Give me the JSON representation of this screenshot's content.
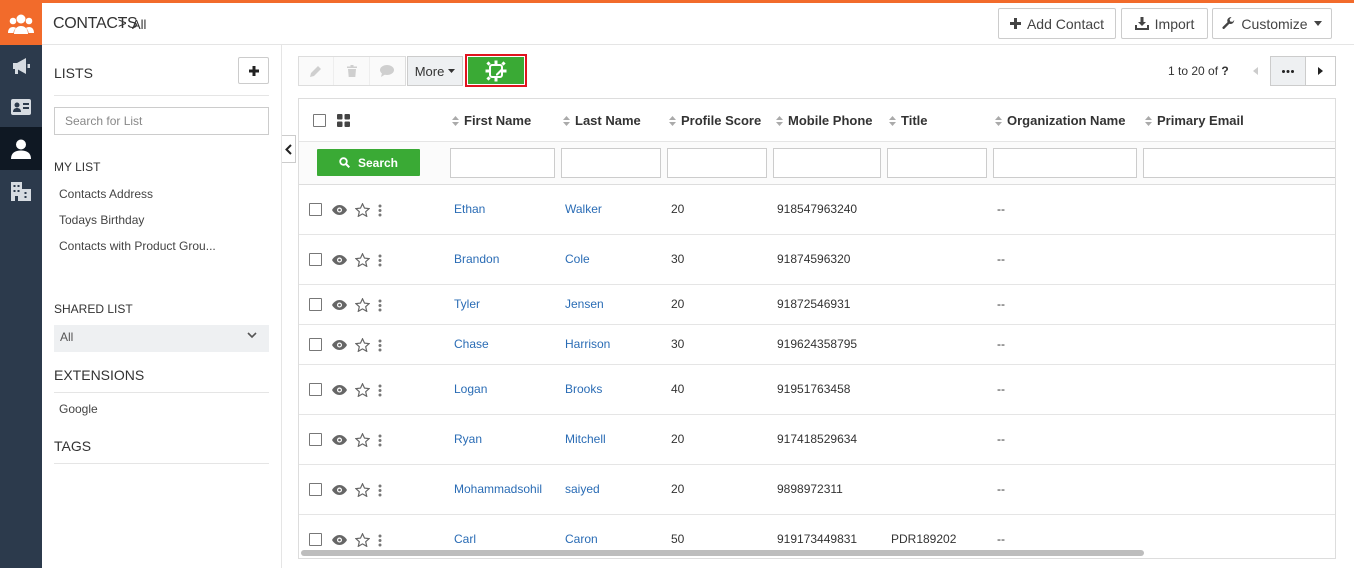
{
  "header": {
    "module": "CONTACTS",
    "separator": ">",
    "current_list": "All",
    "add_label": "Add Contact",
    "import_label": "Import",
    "customize_label": "Customize"
  },
  "lists_panel": {
    "title": "LISTS",
    "search_placeholder": "Search for List",
    "my_list_heading": "MY LIST",
    "my_list_items": [
      "Contacts Address",
      "Todays Birthday",
      "Contacts with Product Grou..."
    ],
    "shared_heading": "SHARED LIST",
    "shared_value": "All",
    "extensions_heading": "EXTENSIONS",
    "extension_items": [
      "Google"
    ],
    "tags_heading": "TAGS"
  },
  "toolbar": {
    "more_label": "More",
    "pager_range": "1 to 20",
    "pager_of": "of",
    "pager_total": "?"
  },
  "table": {
    "columns": [
      "First Name",
      "Last Name",
      "Profile Score",
      "Mobile Phone",
      "Title",
      "Organization Name",
      "Primary Email"
    ],
    "search_label": "Search",
    "rows": [
      {
        "first": "Ethan",
        "last": "Walker",
        "score": "20",
        "phone": "918547963240",
        "title": "",
        "org": "--"
      },
      {
        "first": "Brandon",
        "last": "Cole",
        "score": "30",
        "phone": "91874596320",
        "title": "",
        "org": "--"
      },
      {
        "first": "Tyler",
        "last": "Jensen",
        "score": "20",
        "phone": "91872546931",
        "title": "",
        "org": "--"
      },
      {
        "first": "Chase",
        "last": "Harrison",
        "score": "30",
        "phone": "919624358795",
        "title": "",
        "org": "--"
      },
      {
        "first": "Logan",
        "last": "Brooks",
        "score": "40",
        "phone": "91951763458",
        "title": "",
        "org": "--"
      },
      {
        "first": "Ryan",
        "last": "Mitchell",
        "score": "20",
        "phone": "917418529634",
        "title": "",
        "org": "--"
      },
      {
        "first": "Mohammadsohil",
        "last": "saiyed",
        "score": "20",
        "phone": "9898972311",
        "title": "",
        "org": "--"
      },
      {
        "first": "Carl",
        "last": "Caron",
        "score": "50",
        "phone": "919173449831",
        "title": "PDR189202",
        "org": "--"
      }
    ]
  },
  "colors": {
    "brand_orange": "#f26b2b",
    "rail_bg": "#2c3a4c",
    "action_green": "#3aaa35",
    "link_blue": "#2a6cb5",
    "highlight_red": "#e0131f"
  },
  "icons": {
    "rail": [
      "users-logo-icon",
      "megaphone-icon",
      "contact-card-icon",
      "person-icon",
      "building-icon"
    ],
    "toolbar": [
      "pencil-icon",
      "trash-icon",
      "comment-icon",
      "settings-chip-icon"
    ]
  }
}
